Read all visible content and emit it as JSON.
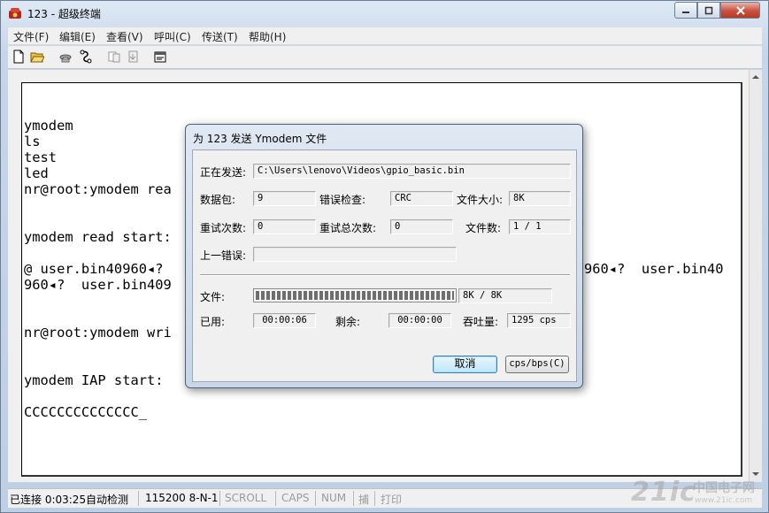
{
  "window": {
    "title": "123 - 超级终端",
    "icon": "phone-terminal-icon"
  },
  "menu": [
    "文件(F)",
    "编辑(E)",
    "查看(V)",
    "呼叫(C)",
    "传送(T)",
    "帮助(H)"
  ],
  "toolbar": [
    "new-icon",
    "open-icon",
    "call-icon",
    "disconnect-icon",
    "send-icon",
    "receive-icon",
    "properties-icon"
  ],
  "terminal": {
    "lines": [
      "ymodem",
      "ls",
      "test",
      "led",
      "nr@root:ymodem rea",
      "",
      "",
      "ymodem read start:",
      "",
      "@ user.bin40960◂?",
      "960◂?  user.bin409",
      "",
      "",
      "nr@root:ymodem wri",
      "",
      "",
      "ymodem IAP start:",
      "",
      "CCCCCCCCCCCCCC_"
    ],
    "right_fragment": "960◂?  user.bin40"
  },
  "dialog": {
    "title": "为 123 发送 Ymodem 文件",
    "sending_label": "正在发送:",
    "sending_value": "C:\\Users\\lenovo\\Videos\\gpio_basic.bin",
    "packet_label": "数据包:",
    "packet_value": "9",
    "error_check_label": "错误检查:",
    "error_check_value": "CRC",
    "file_size_label": "文件大小:",
    "file_size_value": "8K",
    "retries_label": "重试次数:",
    "retries_value": "0",
    "total_retries_label": "重试总次数:",
    "total_retries_value": "0",
    "files_label": "文件数:",
    "files_value": "1 / 1",
    "last_error_label": "上一错误:",
    "last_error_value": "",
    "file_label": "文件:",
    "progress_text": "8K / 8K",
    "progress_fraction": 1.0,
    "elapsed_label": "已用:",
    "elapsed_value": "00:00:06",
    "remaining_label": "剩余:",
    "remaining_value": "00:00:00",
    "throughput_label": "吞吐量:",
    "throughput_value": "1295 cps",
    "cancel_label": "取消",
    "cps_label": "cps/bps(C)"
  },
  "statusbar": {
    "connected": "已连接 0:03:25",
    "detect": "自动检测",
    "port": "115200 8-N-1",
    "scroll": "SCROLL",
    "caps": "CAPS",
    "num": "NUM",
    "capture": "捕",
    "print": "打印"
  },
  "watermark": {
    "logo": "21ic",
    "name": "中国电子网",
    "url": "www.21ic.com"
  }
}
